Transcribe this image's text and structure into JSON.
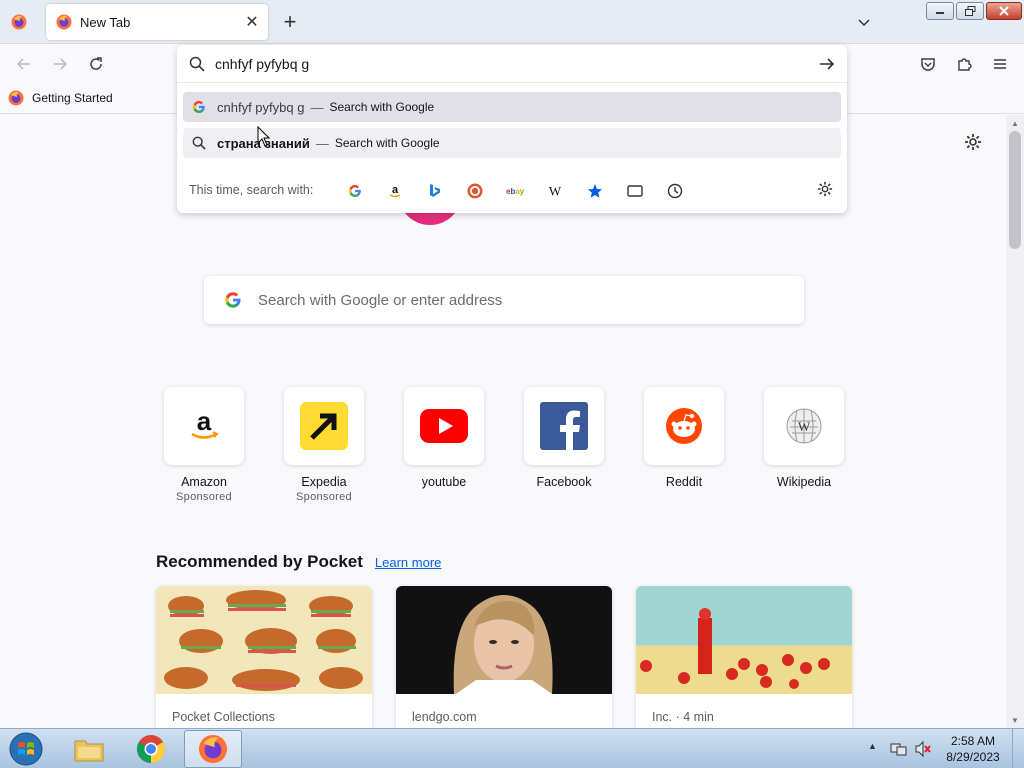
{
  "browser": {
    "tab": {
      "title": "New Tab",
      "close_glyph": "✕"
    },
    "new_tab_glyph": "+",
    "bookmarks": [
      {
        "label": "Getting Started"
      }
    ]
  },
  "urlbar": {
    "value": "cnhfyf pyfybq g",
    "suggestions": [
      {
        "text": "cnhfyf pyfybq g",
        "separator": "—",
        "action": "Search with Google",
        "icon": "google-icon"
      },
      {
        "text": "страна знаний",
        "separator": "—",
        "action": "Search with Google",
        "icon": "search-icon"
      }
    ],
    "oneoff_label": "This time, search with:",
    "engines": [
      "google",
      "amazon",
      "bing",
      "duckduckgo",
      "ebay",
      "wikipedia",
      "bookmarks",
      "tabs",
      "history"
    ]
  },
  "newtab": {
    "search_placeholder": "Search with Google or enter address",
    "top_sites": [
      {
        "title": "Amazon",
        "sponsored": "Sponsored",
        "icon": "amazon-icon"
      },
      {
        "title": "Expedia",
        "sponsored": "Sponsored",
        "icon": "expedia-icon"
      },
      {
        "title": "youtube",
        "sponsored": "",
        "icon": "youtube-icon"
      },
      {
        "title": "Facebook",
        "sponsored": "",
        "icon": "facebook-icon"
      },
      {
        "title": "Reddit",
        "sponsored": "",
        "icon": "reddit-icon"
      },
      {
        "title": "Wikipedia",
        "sponsored": "",
        "icon": "wikipedia-icon"
      }
    ],
    "pocket": {
      "heading": "Recommended by Pocket",
      "learn_more": "Learn more",
      "cards": [
        {
          "source": "Pocket Collections"
        },
        {
          "source": "lendgo.com"
        },
        {
          "source": "Inc. · 4 min"
        }
      ]
    }
  },
  "taskbar": {
    "apps": [
      "explorer",
      "chrome",
      "firefox"
    ],
    "time": "2:58 AM",
    "date": "8/29/2023"
  },
  "colors": {
    "accent": "#0061e0",
    "tabstrip": "#e6ecf4",
    "page_bg": "#f9f9fb"
  }
}
